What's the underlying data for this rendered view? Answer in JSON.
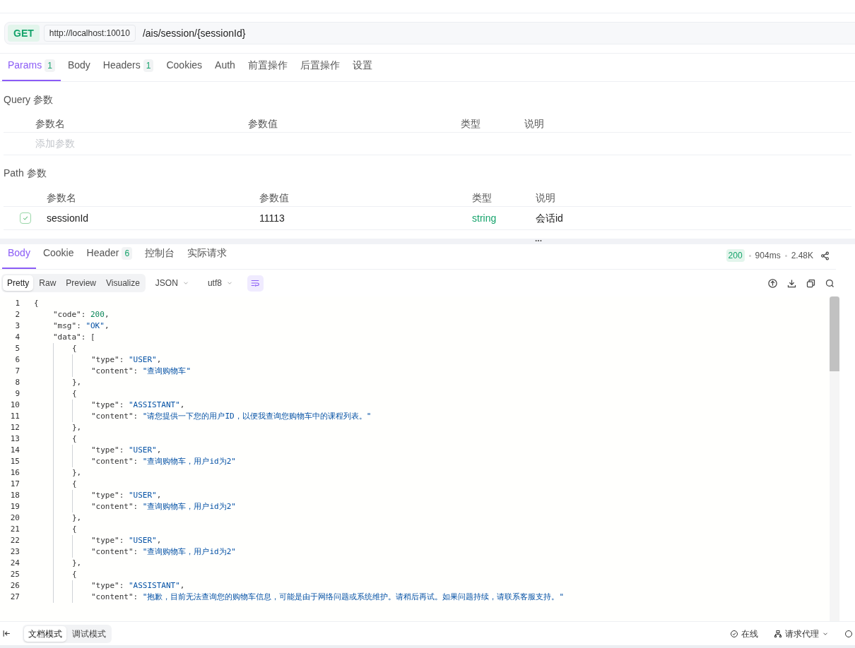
{
  "request": {
    "method": "GET",
    "base_url": "http://localhost:10010",
    "path": "/ais/session/{sessionId}"
  },
  "request_tabs": [
    {
      "label": "Params",
      "count": "1",
      "selected": true
    },
    {
      "label": "Body",
      "selected": false
    },
    {
      "label": "Headers",
      "count": "1",
      "selected": false
    },
    {
      "label": "Cookies",
      "selected": false
    },
    {
      "label": "Auth",
      "selected": false
    },
    {
      "label": "前置操作",
      "selected": false
    },
    {
      "label": "后置操作",
      "selected": false
    },
    {
      "label": "设置",
      "selected": false
    }
  ],
  "query_params": {
    "title": "Query 参数",
    "columns": [
      "参数名",
      "参数值",
      "类型",
      "说明"
    ],
    "placeholder": "添加参数"
  },
  "path_params": {
    "title": "Path 参数",
    "columns": [
      "参数名",
      "参数值",
      "类型",
      "说明"
    ],
    "rows": [
      {
        "checked": true,
        "name": "sessionId",
        "value": "11113",
        "type": "string",
        "description": "会话id"
      }
    ]
  },
  "splitter": "...",
  "response_tabs": [
    {
      "label": "Body",
      "selected": true
    },
    {
      "label": "Cookie",
      "selected": false
    },
    {
      "label": "Header",
      "count": "6",
      "selected": false
    },
    {
      "label": "控制台",
      "selected": false
    },
    {
      "label": "实际请求",
      "selected": false
    }
  ],
  "response_meta": {
    "status": "200",
    "time": "904ms",
    "size": "2.48K"
  },
  "view_modes": [
    {
      "label": "Pretty",
      "selected": true
    },
    {
      "label": "Raw",
      "selected": false
    },
    {
      "label": "Preview",
      "selected": false
    },
    {
      "label": "Visualize",
      "selected": false
    }
  ],
  "format": "JSON",
  "encoding": "utf8",
  "code_lines": [
    {
      "number": "1",
      "text": "{"
    },
    {
      "number": "2",
      "text": "    \"code\": 200,"
    },
    {
      "number": "3",
      "text": "    \"msg\": \"OK\","
    },
    {
      "number": "4",
      "text": "    \"data\": ["
    },
    {
      "number": "5",
      "text": "        {"
    },
    {
      "number": "6",
      "text": "            \"type\": \"USER\","
    },
    {
      "number": "7",
      "text": "            \"content\": \"查询购物车\""
    },
    {
      "number": "8",
      "text": "        },"
    },
    {
      "number": "9",
      "text": "        {"
    },
    {
      "number": "10",
      "text": "            \"type\": \"ASSISTANT\","
    },
    {
      "number": "11",
      "text": "            \"content\": \"请您提供一下您的用户ID，以便我查询您购物车中的课程列表。\""
    },
    {
      "number": "12",
      "text": "        },"
    },
    {
      "number": "13",
      "text": "        {"
    },
    {
      "number": "14",
      "text": "            \"type\": \"USER\","
    },
    {
      "number": "15",
      "text": "            \"content\": \"查询购物车，用户id为2\""
    },
    {
      "number": "16",
      "text": "        },"
    },
    {
      "number": "17",
      "text": "        {"
    },
    {
      "number": "18",
      "text": "            \"type\": \"USER\","
    },
    {
      "number": "19",
      "text": "            \"content\": \"查询购物车，用户id为2\""
    },
    {
      "number": "20",
      "text": "        },"
    },
    {
      "number": "21",
      "text": "        {"
    },
    {
      "number": "22",
      "text": "            \"type\": \"USER\","
    },
    {
      "number": "23",
      "text": "            \"content\": \"查询购物车，用户id为2\""
    },
    {
      "number": "24",
      "text": "        },"
    },
    {
      "number": "25",
      "text": "        {"
    },
    {
      "number": "26",
      "text": "            \"type\": \"ASSISTANT\","
    },
    {
      "number": "27",
      "text": "            \"content\": \"抱歉，目前无法查询您的购物车信息，可能是由于网络问题或系统维护。请稍后再试。如果问题持续，请联系客服支持。\""
    }
  ],
  "footer": {
    "modes": [
      {
        "label": "文档模式",
        "selected": true
      },
      {
        "label": "调试模式",
        "selected": false
      }
    ],
    "online": "在线",
    "proxy": "请求代理"
  }
}
